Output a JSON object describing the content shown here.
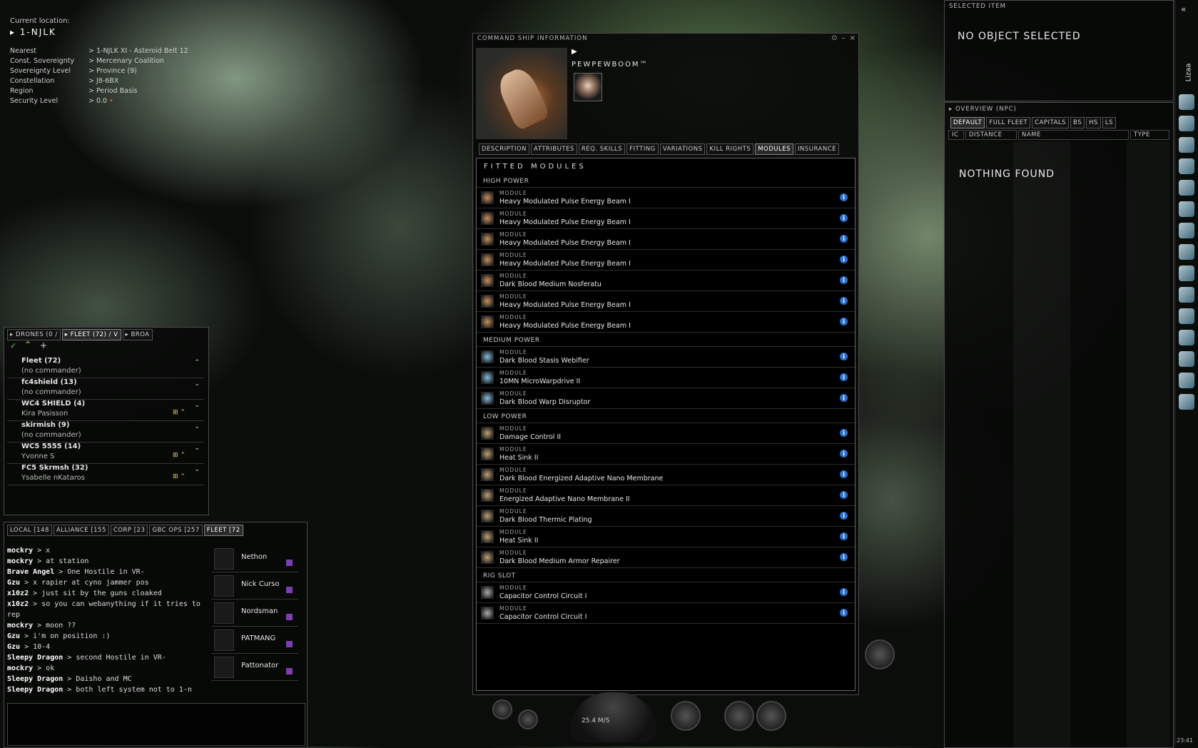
{
  "location": {
    "label": "Current location:",
    "system": "1-NJLK",
    "rows": [
      {
        "k": "Nearest",
        "v": "1-NJLK XI - Asteroid Belt 12"
      },
      {
        "k": "Const. Sovereignty",
        "v": "Mercenary Coalition"
      },
      {
        "k": "Sovereignty Level",
        "v": "Province (9)"
      },
      {
        "k": "Constellation",
        "v": "J8-6BX"
      },
      {
        "k": "Region",
        "v": "Period Basis"
      },
      {
        "k": "Security Level",
        "v": "0.0"
      }
    ]
  },
  "command_ship": {
    "window_title": "COMMAND SHIP INFORMATION",
    "ship_name": "PEWPEWBOOM™",
    "tabs": [
      "DESCRIPTION",
      "ATTRIBUTES",
      "REQ. SKILLS",
      "FITTING",
      "VARIATIONS",
      "KILL RIGHTS",
      "MODULES",
      "INSURANCE"
    ],
    "active_tab": "MODULES",
    "fitted_title": "FITTED MODULES",
    "module_label": "MODULE",
    "sections": [
      {
        "name": "HIGH POWER",
        "modules": [
          "Heavy Modulated Pulse Energy Beam I",
          "Heavy Modulated Pulse Energy Beam I",
          "Heavy Modulated Pulse Energy Beam I",
          "Heavy Modulated Pulse Energy Beam I",
          "Dark Blood Medium Nosferatu",
          "Heavy Modulated Pulse Energy Beam I",
          "Heavy Modulated Pulse Energy Beam I"
        ]
      },
      {
        "name": "MEDIUM POWER",
        "modules": [
          "Dark Blood Stasis Webifier",
          "10MN MicroWarpdrive II",
          "Dark Blood Warp Disruptor"
        ]
      },
      {
        "name": "LOW POWER",
        "modules": [
          "Damage Control II",
          "Heat Sink II",
          "Dark Blood Energized Adaptive Nano Membrane",
          "Energized Adaptive Nano Membrane II",
          "Dark Blood Thermic Plating",
          "Heat Sink II",
          "Dark Blood Medium Armor Repairer"
        ]
      },
      {
        "name": "RIG SLOT",
        "modules": [
          "Capacitor Control Circuit I",
          "Capacitor Control Circuit I"
        ]
      }
    ]
  },
  "selected_item": {
    "title": "SELECTED ITEM",
    "message": "NO OBJECT SELECTED"
  },
  "overview": {
    "title": "OVERVIEW (NPC)",
    "tabs": [
      "DEFAULT",
      "FULL FLEET",
      "CAPITALS",
      "BS",
      "HS",
      "LS"
    ],
    "columns": [
      "IC",
      "DISTANCE",
      "NAME",
      "TYPE"
    ],
    "message": "NOTHING FOUND"
  },
  "neocom": {
    "label": "Lizaa",
    "clock": "23:41"
  },
  "fleet": {
    "tabs": [
      "DRONES (0 /",
      "FLEET (72) / V",
      "BROA"
    ],
    "groups": [
      {
        "name": "Fleet (72)",
        "commander": "(no commander)"
      },
      {
        "name": "fc4shield (13)",
        "commander": "(no commander)"
      },
      {
        "name": "WC4 SHIELD (4)",
        "commander": "Kira Pasisson"
      },
      {
        "name": "skirmish (9)",
        "commander": "(no commander)"
      },
      {
        "name": "WC5 5555 (14)",
        "commander": "Yvonne S"
      },
      {
        "name": "FC5 Skrmsh (32)",
        "commander": "Ysabelle nKataros"
      }
    ]
  },
  "chat": {
    "tabs": [
      "LOCAL [148",
      "ALLIANCE [155",
      "CORP [23",
      "GBC OPS [257",
      "FLEET [72"
    ],
    "messages": [
      {
        "who": "mockry",
        "text": "x"
      },
      {
        "who": "mockry",
        "text": "at station"
      },
      {
        "who": "Brave Angel",
        "text": "One Hostile in VR-"
      },
      {
        "who": "Gzu",
        "text": "x rapier at cyno jammer pos"
      },
      {
        "who": "x10z2",
        "text": "just sit by the guns cloaked"
      },
      {
        "who": "x10z2",
        "text": "so you can webanything if it tries to"
      },
      {
        "who": "",
        "text": "rep"
      },
      {
        "who": "mockry",
        "text": "moon ??"
      },
      {
        "who": "Gzu",
        "text": "i'm on position :)"
      },
      {
        "who": "Gzu",
        "text": "10-4"
      },
      {
        "who": "Sleepy Dragon",
        "text": "second Hostile in VR-"
      },
      {
        "who": "mockry",
        "text": "ok"
      },
      {
        "who": "Sleepy Dragon",
        "text": "Daisho and MC"
      },
      {
        "who": "Sleepy Dragon",
        "text": "both left system not to 1-n"
      }
    ],
    "members": [
      "Nethon",
      "Nick Curso",
      "Nordsman",
      "PATMANG",
      "Pattonator"
    ]
  },
  "hud": {
    "speed": "25.4 M/S"
  }
}
